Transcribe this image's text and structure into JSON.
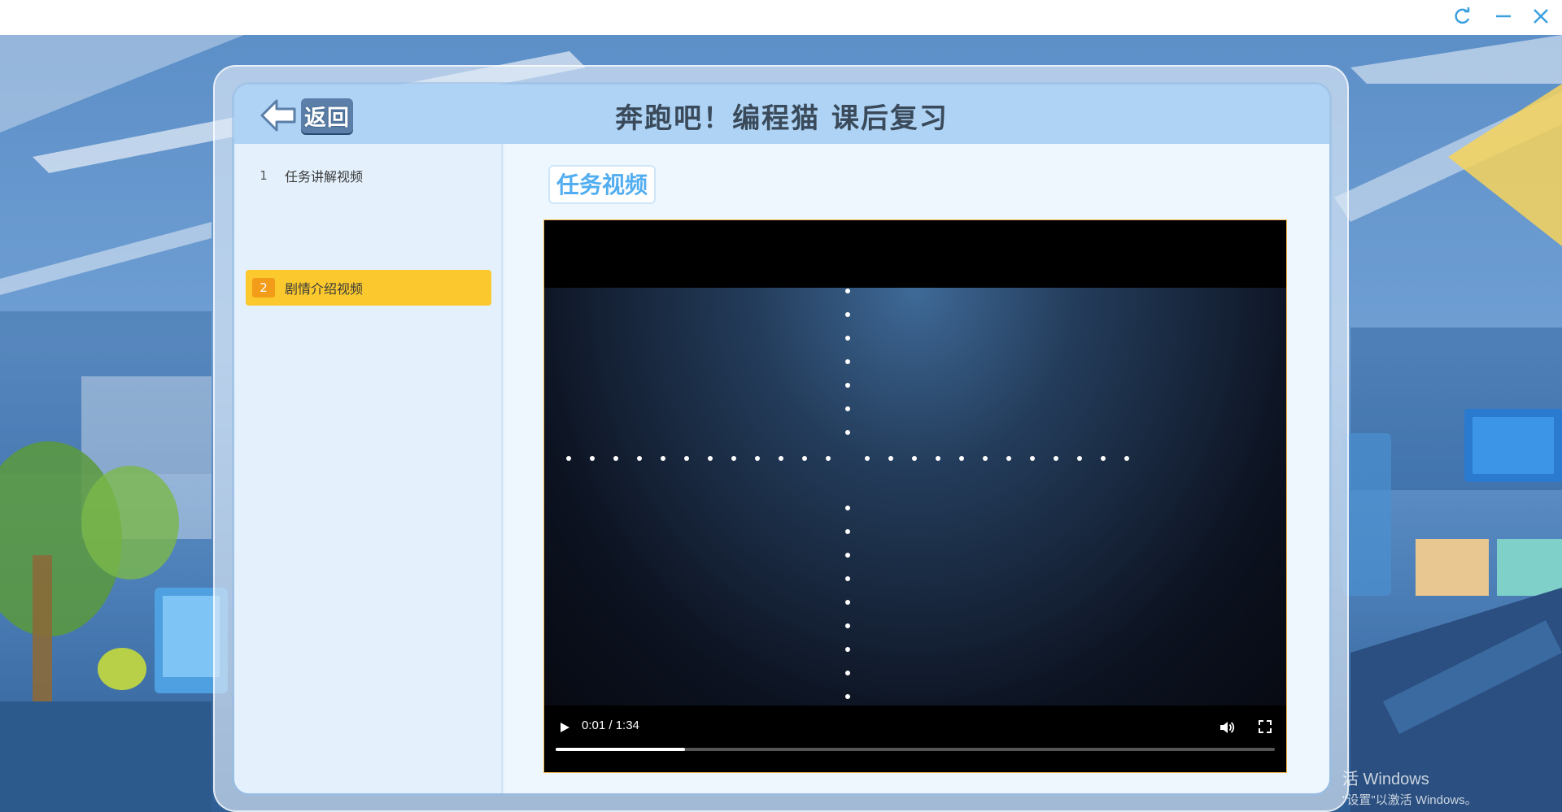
{
  "window": {
    "controls": [
      "refresh",
      "minimize",
      "close"
    ]
  },
  "header": {
    "back_label": "返回",
    "title": "奔跑吧！编程猫 课后复习"
  },
  "sidebar": {
    "items": [
      {
        "num": "1",
        "label": "任务讲解视频",
        "active": false
      },
      {
        "num": "2",
        "label": "剧情介绍视频",
        "active": true
      }
    ]
  },
  "content": {
    "section_title": "任务视频"
  },
  "player": {
    "time": "0:01 / 1:34",
    "progress": 0.18,
    "state": "paused"
  },
  "watermark": {
    "line1": "活 Windows",
    "line2": "\"设置\"以激活 Windows。"
  },
  "colors": {
    "accent": "#fbc92e",
    "accent_num": "#f39c1a",
    "header_bg": "#aed3f5",
    "section_title": "#52aef0",
    "window_ctrl": "#3aa0e0"
  }
}
